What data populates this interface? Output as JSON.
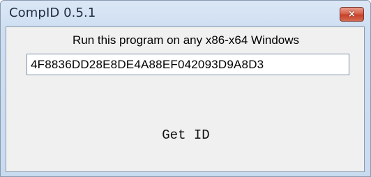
{
  "window": {
    "title": "CompID 0.5.1",
    "close_symbol": "×"
  },
  "content": {
    "caption": "Run this program on any x86-x64 Windows",
    "id_value": "4F8836DD28E8DE4A88EF042093D9A8D3",
    "button_label": "Get ID"
  },
  "icons": {
    "close": "close-icon"
  },
  "colors": {
    "titlebar": "#cfdff2",
    "close_button": "#d9604a",
    "client_background": "#f0f0f0"
  }
}
